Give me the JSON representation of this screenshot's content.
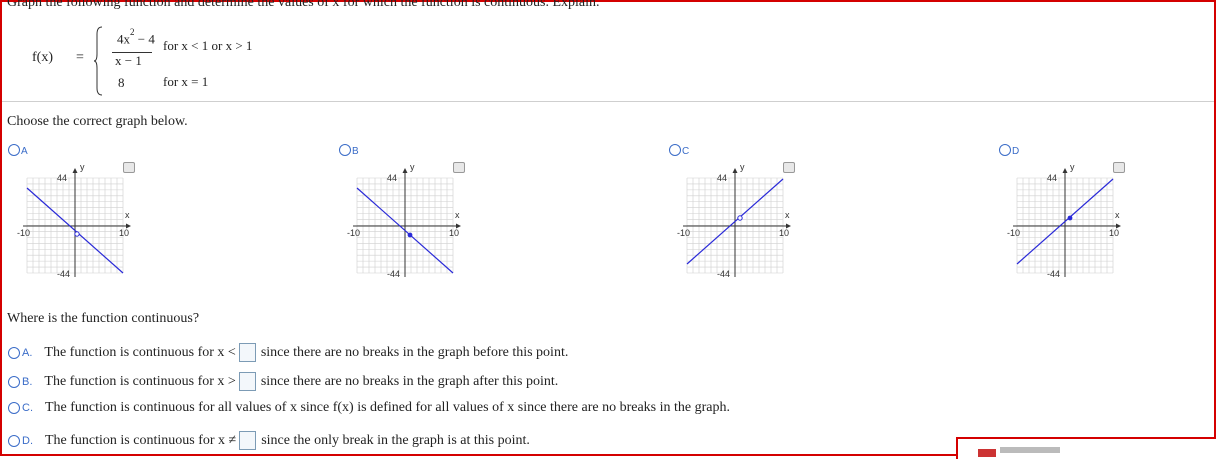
{
  "question": {
    "prompt": "Graph the following function and determine the values of x for which the function is continuous. Explain.",
    "fx_label": "f(x)",
    "equals": "=",
    "numerator_base": "4x",
    "numerator_exp": "2",
    "numerator_rest": " − 4",
    "denominator": "x − 1",
    "condition1": "for x < 1 or x > 1",
    "value2": "8",
    "condition2": "for x = 1"
  },
  "graph_section": {
    "instruction": "Choose the correct graph below.",
    "options": [
      {
        "letter": "A",
        "ytick": "44",
        "ytick_neg": "-44",
        "xtick_neg": "-10",
        "xtick_pos": "10",
        "xlabel": "x",
        "ylabel": "y"
      },
      {
        "letter": "B",
        "ytick": "44",
        "ytick_neg": "-44",
        "xtick_neg": "-10",
        "xtick_pos": "10",
        "xlabel": "x",
        "ylabel": "y"
      },
      {
        "letter": "C",
        "ytick": "44",
        "ytick_neg": "-44",
        "xtick_neg": "-10",
        "xtick_pos": "10",
        "xlabel": "x",
        "ylabel": "y"
      },
      {
        "letter": "D",
        "ytick": "44",
        "ytick_neg": "-44",
        "xtick_neg": "-10",
        "xtick_pos": "10",
        "xlabel": "x",
        "ylabel": "y"
      }
    ]
  },
  "continuity_section": {
    "question": "Where is the function continuous?",
    "answers": [
      {
        "letter": "A.",
        "before": "The function is continuous for x <",
        "after": "since there are no breaks in the graph before this point."
      },
      {
        "letter": "B.",
        "before": "The function is continuous for x >",
        "after": "since there are no breaks in the graph after this point."
      },
      {
        "letter": "C.",
        "before": "The function is continuous for all values of x since f(x) is defined for all values of x since there are no breaks in the graph.",
        "after": ""
      },
      {
        "letter": "D.",
        "before": "The function is continuous for x ≠",
        "after": "since the only break in the graph is at this point."
      }
    ]
  },
  "colors": {
    "accent": "#3a6cc8",
    "frame": "#d40000",
    "line": "#2a2ad8"
  }
}
